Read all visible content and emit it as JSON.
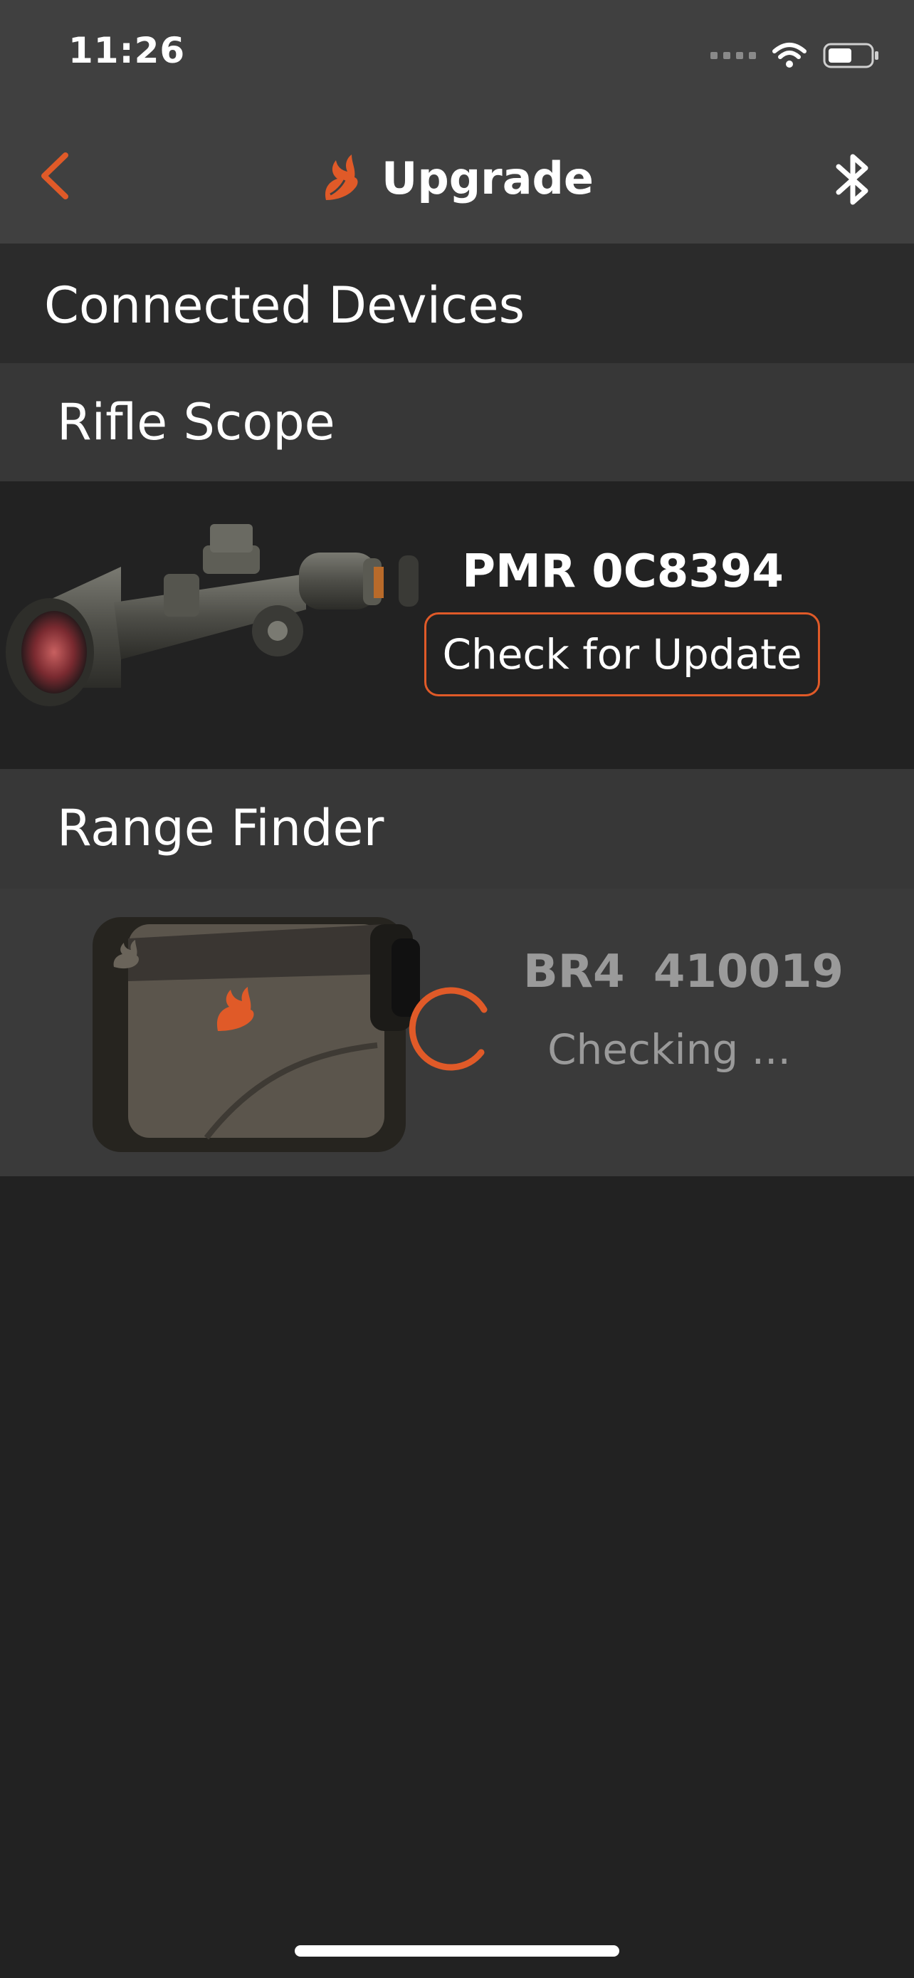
{
  "status": {
    "time": "11:26"
  },
  "nav": {
    "title": "Upgrade"
  },
  "sections": {
    "connected_devices": "Connected Devices"
  },
  "groups": {
    "rifle_scope": {
      "label": "Rifle Scope",
      "device_name": "PMR 0C8394",
      "button_label": "Check for Update"
    },
    "range_finder": {
      "label": "Range Finder",
      "device_name": "BR4  410019",
      "status_text": "Checking ..."
    }
  },
  "colors": {
    "accent": "#e05a28",
    "bar_bg": "#404040",
    "page_bg": "#222222",
    "muted_text": "#9a9a9a"
  },
  "icons": [
    "back-chevron-icon",
    "brand-logo-icon",
    "bluetooth-icon",
    "wifi-icon",
    "battery-icon",
    "loading-spinner-icon"
  ]
}
